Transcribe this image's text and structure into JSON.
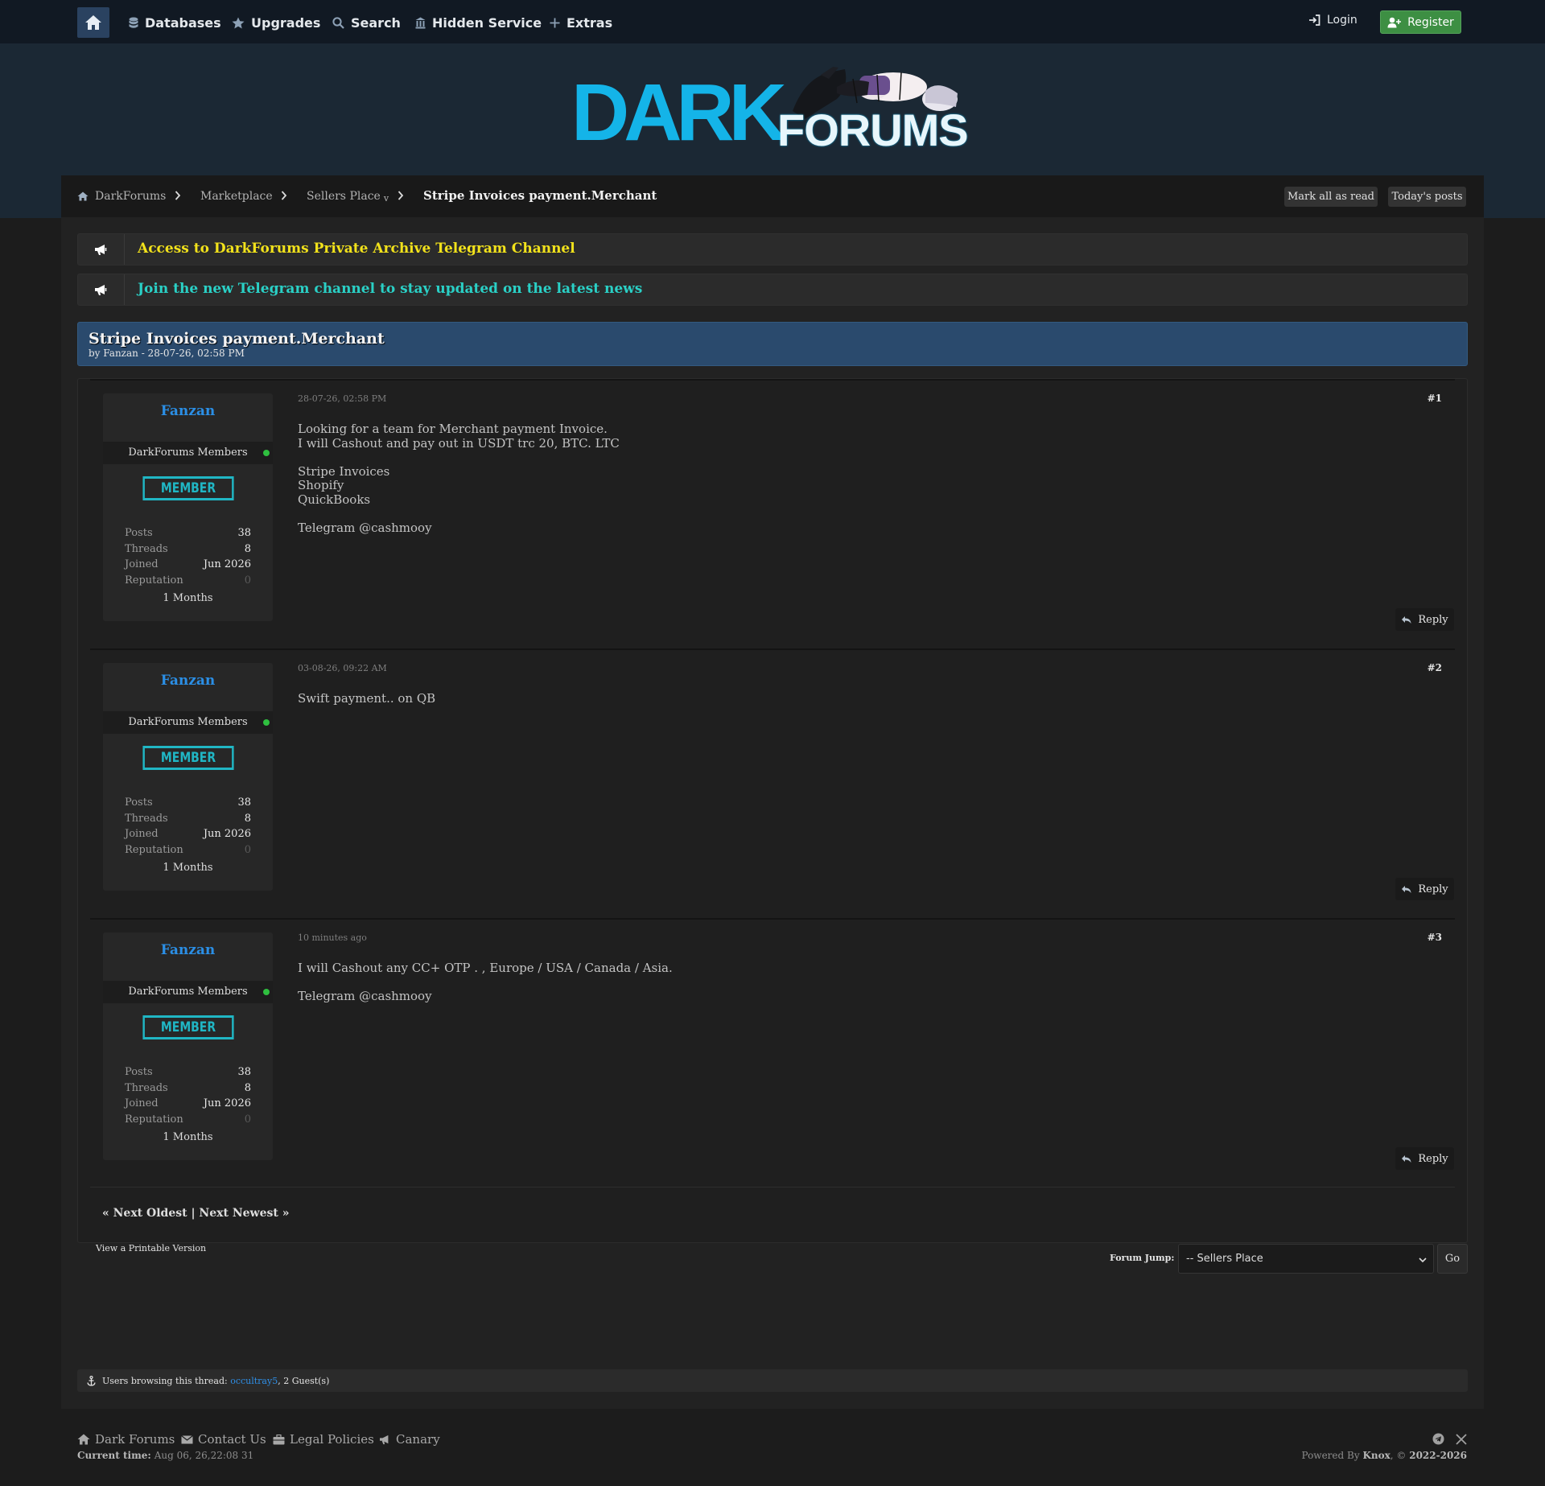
{
  "nav": {
    "items": [
      {
        "label": "Databases",
        "icon": "database-icon"
      },
      {
        "label": "Upgrades",
        "icon": "star-icon"
      },
      {
        "label": "Search",
        "icon": "search-icon"
      },
      {
        "label": "Hidden Service",
        "icon": "building-icon"
      },
      {
        "label": "Extras",
        "icon": "plus-icon"
      }
    ],
    "login": "Login",
    "register": "Register"
  },
  "logo": {
    "word1": "DARK",
    "word2": "FORUMS",
    "primary_color": "#14b4e8"
  },
  "breadcrumb": {
    "items": [
      "DarkForums",
      "Marketplace",
      "Sellers Place"
    ],
    "dropdown_mark": "v",
    "current": "Stripe Invoices payment.Merchant",
    "mark_read": "Mark all as read",
    "todays_posts": "Today's posts"
  },
  "announcements": [
    {
      "text": "Access to DarkForums Private Archive Telegram Channel",
      "color": "#f2e21b"
    },
    {
      "text": "Join the new Telegram channel to stay updated on the latest news",
      "color": "#2ad0c6"
    }
  ],
  "thread": {
    "title": "Stripe Invoices payment.Merchant",
    "byline": "by Fanzan - 28-07-26, 02:58 PM"
  },
  "posts": [
    {
      "author": "Fanzan",
      "group": "DarkForums Members",
      "badge": "MEMBER",
      "stats": [
        {
          "label": "Posts",
          "value": "38"
        },
        {
          "label": "Threads",
          "value": "8"
        },
        {
          "label": "Joined",
          "value": "Jun 2026"
        },
        {
          "label": "Reputation",
          "value": "0"
        }
      ],
      "tenure": "1 Months",
      "date": "28-07-26, 02:58 PM",
      "number": "#1",
      "lines": [
        "Looking for a team for Merchant payment Invoice.",
        "I will Cashout and pay out in USDT trc 20, BTC. LTC",
        "",
        "Stripe Invoices",
        "Shopify",
        "QuickBooks",
        "",
        "Telegram @cashmooy"
      ],
      "reply": "Reply"
    },
    {
      "author": "Fanzan",
      "group": "DarkForums Members",
      "badge": "MEMBER",
      "stats": [
        {
          "label": "Posts",
          "value": "38"
        },
        {
          "label": "Threads",
          "value": "8"
        },
        {
          "label": "Joined",
          "value": "Jun 2026"
        },
        {
          "label": "Reputation",
          "value": "0"
        }
      ],
      "tenure": "1 Months",
      "date": "03-08-26, 09:22 AM",
      "number": "#2",
      "lines": [
        "Swift payment.. on QB"
      ],
      "reply": "Reply"
    },
    {
      "author": "Fanzan",
      "group": "DarkForums Members",
      "badge": "MEMBER",
      "stats": [
        {
          "label": "Posts",
          "value": "38"
        },
        {
          "label": "Threads",
          "value": "8"
        },
        {
          "label": "Joined",
          "value": "Jun 2026"
        },
        {
          "label": "Reputation",
          "value": "0"
        }
      ],
      "tenure": "1 Months",
      "date": "10 minutes ago",
      "number": "#3",
      "lines": [
        "I will Cashout any CC+ OTP . , Europe / USA / Canada / Asia.",
        "",
        "Telegram @cashmooy"
      ],
      "reply": "Reply"
    }
  ],
  "pager": {
    "prev": "« Next Oldest",
    "sep": "|",
    "next": "Next Newest »"
  },
  "printable": "View a Printable Version",
  "forum_jump": {
    "label": "Forum Jump:",
    "selected": "-- Sellers Place",
    "go": "Go"
  },
  "browsing": {
    "prefix": "Users browsing this thread:",
    "user": "occultray5",
    "suffix": ", 2 Guest(s)"
  },
  "footer": {
    "links": [
      "Dark Forums",
      "Contact Us",
      "Legal Policies",
      "Canary"
    ],
    "current_time_label": "Current time:",
    "current_time": "Aug 06, 26,22:08 31",
    "powered_prefix": "Powered By",
    "powered_name": "Knox",
    "powered_mid": ", ©",
    "powered_years": "2022-2026"
  }
}
